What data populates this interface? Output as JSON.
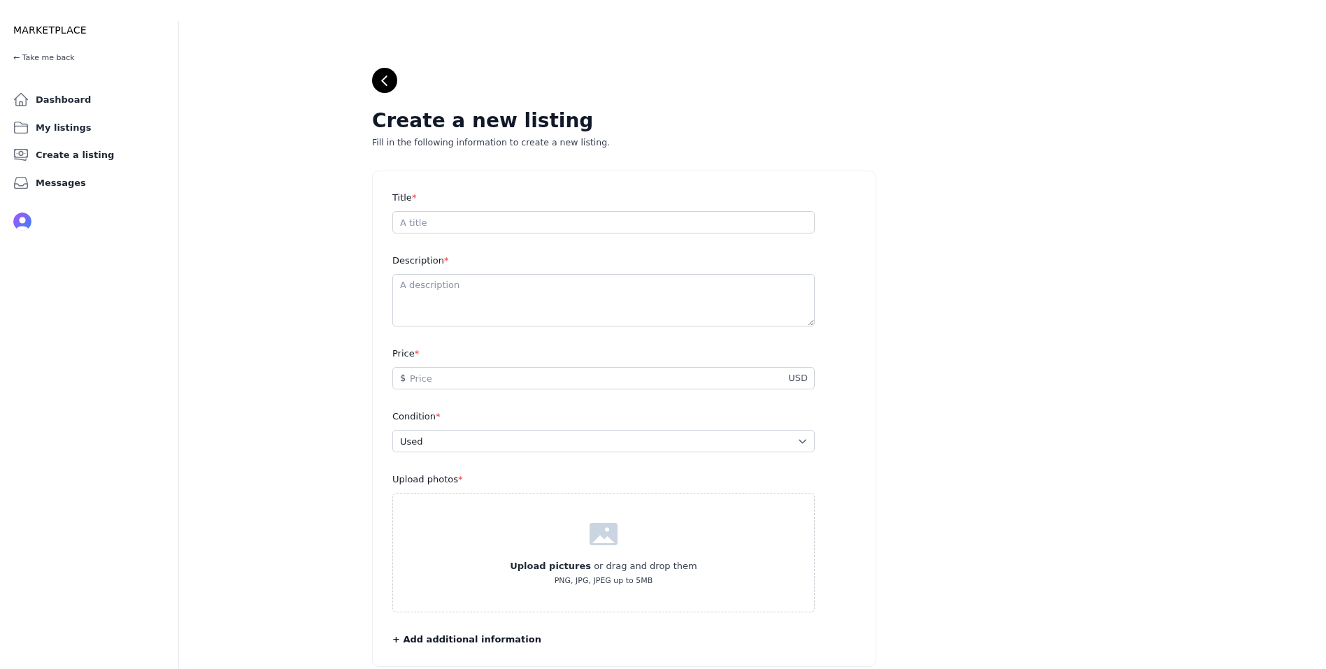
{
  "sidebar": {
    "brand": "MARKETPLACE",
    "back_link": "← Take me back",
    "items": [
      {
        "label": "Dashboard"
      },
      {
        "label": "My listings"
      },
      {
        "label": "Create a listing"
      },
      {
        "label": "Messages"
      }
    ]
  },
  "page": {
    "title": "Create a new listing",
    "subtitle": "Fill in the following information to create a new listing."
  },
  "form": {
    "fields": [
      {
        "kind": "text",
        "label": "Title",
        "required_mark": "*",
        "placeholder": "A title"
      },
      {
        "kind": "textarea",
        "label": "Description",
        "required_mark": "*",
        "placeholder": "A description"
      },
      {
        "kind": "price",
        "label": "Price",
        "required_mark": "*",
        "prefix": "$",
        "placeholder": "Price",
        "suffix": "USD"
      },
      {
        "kind": "select",
        "label": "Condition",
        "required_mark": "*",
        "value": "Used"
      },
      {
        "kind": "upload",
        "label": "Upload photos",
        "required_mark": "*",
        "link": "Upload pictures",
        "text": "or drag and drop them",
        "note": "PNG, JPG, JPEG up to 5MB"
      }
    ],
    "add_more": "+ Add additional information"
  }
}
